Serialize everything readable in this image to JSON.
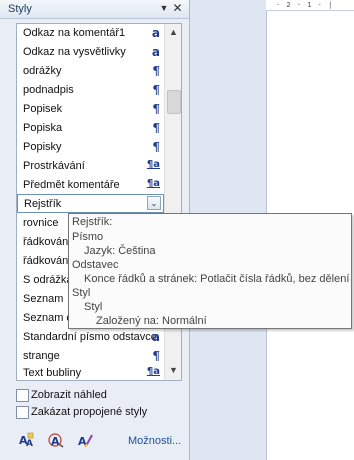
{
  "pane": {
    "title": "Styly",
    "menu_glyph": "▼",
    "close_glyph": "✕"
  },
  "styles": [
    {
      "name": "Odkaz na komentář1",
      "type_glyph": "a",
      "kind": "char"
    },
    {
      "name": "Odkaz na vysvětlivky",
      "type_glyph": "a",
      "kind": "char"
    },
    {
      "name": "odrážky",
      "type_glyph": "¶",
      "kind": "para"
    },
    {
      "name": "podnadpis",
      "type_glyph": "¶",
      "kind": "para"
    },
    {
      "name": "Popisek",
      "type_glyph": "¶",
      "kind": "para"
    },
    {
      "name": "Popiska",
      "type_glyph": "¶",
      "kind": "para"
    },
    {
      "name": "Popisky",
      "type_glyph": "¶",
      "kind": "para"
    },
    {
      "name": "Prostrkávání",
      "type_glyph": "¶a",
      "kind": "linked"
    },
    {
      "name": "Předmět komentáře",
      "type_glyph": "¶a",
      "kind": "linked"
    },
    {
      "name": "Rejstřík",
      "type_glyph": "",
      "kind": "selected"
    },
    {
      "name": "rovnice",
      "type_glyph": "",
      "kind": "para"
    },
    {
      "name": "řádkování",
      "type_glyph": "",
      "kind": "para"
    },
    {
      "name": "řádkování",
      "type_glyph": "",
      "kind": "para"
    },
    {
      "name": "S odrážkam",
      "type_glyph": "",
      "kind": "para"
    },
    {
      "name": "Seznam",
      "type_glyph": "",
      "kind": "para"
    },
    {
      "name": "Seznam ob",
      "type_glyph": "",
      "kind": "para"
    },
    {
      "name": "Standardní písmo odstavce",
      "type_glyph": "a",
      "kind": "char"
    },
    {
      "name": "strange",
      "type_glyph": "¶",
      "kind": "para"
    },
    {
      "name": "Text bubliny",
      "type_glyph": "¶a",
      "kind": "linked"
    }
  ],
  "selected_dropdown_glyph": "⌄",
  "scrollbar": {
    "up_glyph": "▲",
    "down_glyph": "▼"
  },
  "options": {
    "show_preview": "Zobrazit náhled",
    "disable_linked": "Zakázat propojené styly"
  },
  "toolbar": {
    "new_style_icon": "new-style-icon",
    "style_inspector_icon": "style-inspector-icon",
    "manage_styles_icon": "manage-styles-icon",
    "options_link": "Možnosti..."
  },
  "ruler": {
    "marks": "· 2 · 1 · |"
  },
  "tooltip": {
    "lines": [
      "Rejstřík:",
      "Písmo",
      "Jazyk:  Čeština",
      "Odstavec",
      "Konce řádků a stránek:  Potlačit čísla řádků, bez dělení",
      "Styl",
      "Styl",
      "Založený na: Normální"
    ]
  },
  "colors": {
    "type_glyph": "#1f3b8c",
    "link": "#1d4f9a"
  }
}
